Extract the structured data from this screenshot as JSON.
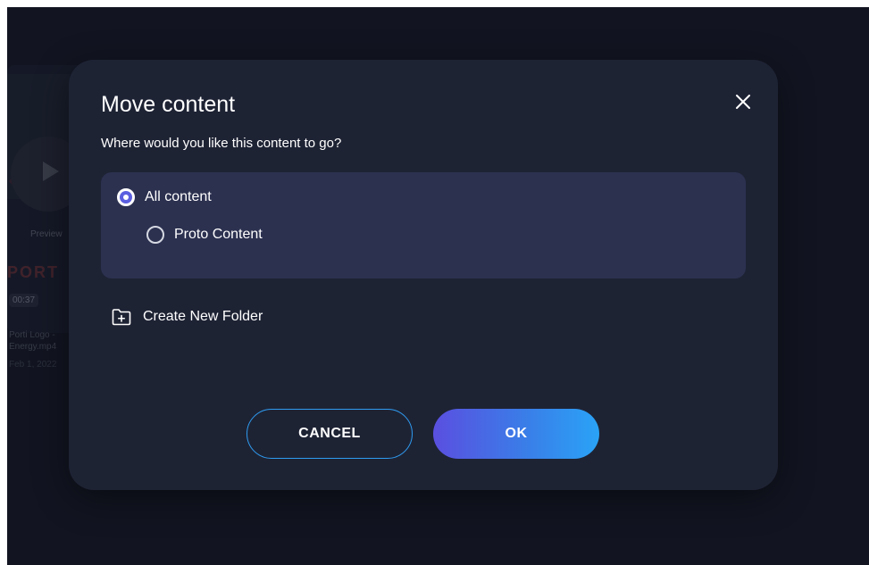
{
  "background": {
    "preview_label": "Preview",
    "brand_text": "PORT",
    "duration": "00:37",
    "file_name": "Porti Logo - Energy.mp4",
    "file_date": "Feb 1, 2022"
  },
  "modal": {
    "title": "Move content",
    "subtitle": "Where would you like this content to go?",
    "close_icon": "close-icon",
    "folders": [
      {
        "label": "All content",
        "selected": true
      },
      {
        "label": "Proto Content",
        "selected": false
      }
    ],
    "create_folder_label": "Create New Folder",
    "create_folder_icon": "folder-plus-icon",
    "cancel_label": "CANCEL",
    "ok_label": "OK"
  },
  "colors": {
    "app_background": "#161a27",
    "modal_background": "#1e2334",
    "folder_list_background": "#2c3150",
    "radio_selected": "#5b5fe0",
    "cancel_border": "#2e9bf0",
    "ok_gradient_start": "#5a4fe0",
    "ok_gradient_end": "#2aa3f6"
  }
}
